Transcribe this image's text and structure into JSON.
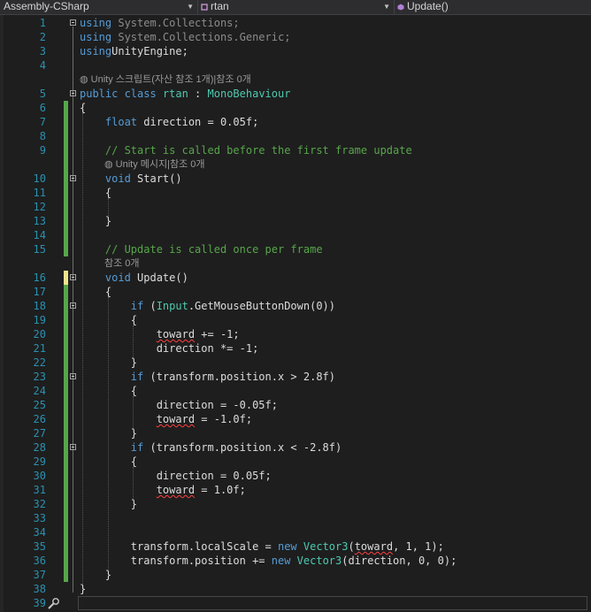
{
  "navbar": {
    "project": "Assembly-CSharp",
    "class_name": "rtan",
    "member": "Update()"
  },
  "code_lens": {
    "class_refs": "Unity 스크립트(자산 참조 1개)|참조 0개",
    "start_refs": "Unity 메시지|참조 0개",
    "update_refs": "참조 0개"
  },
  "editor": {
    "colors": {
      "background": "#1e1e1e",
      "keyword": "#569cd6",
      "type": "#4ec9b0",
      "comment": "#57a64a",
      "line_number": "#2b91af"
    },
    "lines": [
      {
        "n": "1",
        "fold": true,
        "t": [
          [
            "kw",
            "using"
          ],
          [
            "dim",
            " System.Collections;"
          ]
        ]
      },
      {
        "n": "2",
        "t": [
          [
            "kw",
            "using"
          ],
          [
            "dim",
            " System.Collections.Generic;"
          ]
        ]
      },
      {
        "n": "3",
        "t": [
          [
            "kw",
            "using"
          ],
          [
            "",
            "UnityEngine;"
          ]
        ]
      },
      {
        "n": "4",
        "t": []
      },
      {
        "lens": "class_refs",
        "indent": 0
      },
      {
        "n": "5",
        "fold": true,
        "t": [
          [
            "kw",
            "public class "
          ],
          [
            "typ",
            "rtan"
          ],
          [
            "",
            " : "
          ],
          [
            "typ",
            "MonoBehaviour"
          ]
        ]
      },
      {
        "n": "6",
        "t": [
          [
            "",
            "{"
          ]
        ]
      },
      {
        "n": "7",
        "t": [
          [
            "",
            "    "
          ],
          [
            "kw",
            "float"
          ],
          [
            "",
            " direction = 0.05f;"
          ]
        ]
      },
      {
        "n": "8",
        "t": []
      },
      {
        "n": "9",
        "t": [
          [
            "",
            "    "
          ],
          [
            "cm",
            "// Start is called before the first frame update"
          ]
        ]
      },
      {
        "lens": "start_refs",
        "indent": 1
      },
      {
        "n": "10",
        "fold": true,
        "t": [
          [
            "",
            "    "
          ],
          [
            "kw",
            "void"
          ],
          [
            "",
            " Start()"
          ]
        ]
      },
      {
        "n": "11",
        "t": [
          [
            "",
            "    {"
          ]
        ]
      },
      {
        "n": "12",
        "t": []
      },
      {
        "n": "13",
        "t": [
          [
            "",
            "    }"
          ]
        ]
      },
      {
        "n": "14",
        "t": []
      },
      {
        "n": "15",
        "t": [
          [
            "",
            "    "
          ],
          [
            "cm",
            "// Update is called once per frame"
          ]
        ]
      },
      {
        "lens": "update_refs",
        "indent": 1
      },
      {
        "n": "16",
        "fold": true,
        "t": [
          [
            "",
            "    "
          ],
          [
            "kw",
            "void"
          ],
          [
            "",
            " Update()"
          ]
        ]
      },
      {
        "n": "17",
        "t": [
          [
            "",
            "    {"
          ]
        ]
      },
      {
        "n": "18",
        "fold": true,
        "t": [
          [
            "",
            "        "
          ],
          [
            "kw",
            "if"
          ],
          [
            "",
            " ("
          ],
          [
            "typ",
            "Input"
          ],
          [
            "",
            ".GetMouseButtonDown(0))"
          ]
        ]
      },
      {
        "n": "19",
        "t": [
          [
            "",
            "        {"
          ]
        ]
      },
      {
        "n": "20",
        "t": [
          [
            "",
            "            "
          ],
          [
            "squig",
            "toward"
          ],
          [
            "",
            " += -1;"
          ]
        ]
      },
      {
        "n": "21",
        "t": [
          [
            "",
            "            direction *= -1;"
          ]
        ]
      },
      {
        "n": "22",
        "t": [
          [
            "",
            "        }"
          ]
        ]
      },
      {
        "n": "23",
        "fold": true,
        "t": [
          [
            "",
            "        "
          ],
          [
            "kw",
            "if"
          ],
          [
            "",
            " (transform.position.x > 2.8f)"
          ]
        ]
      },
      {
        "n": "24",
        "t": [
          [
            "",
            "        {"
          ]
        ]
      },
      {
        "n": "25",
        "t": [
          [
            "",
            "            direction = -0.05f;"
          ]
        ]
      },
      {
        "n": "26",
        "t": [
          [
            "",
            "            "
          ],
          [
            "squig",
            "toward"
          ],
          [
            "",
            " = -1.0f;"
          ]
        ]
      },
      {
        "n": "27",
        "t": [
          [
            "",
            "        }"
          ]
        ]
      },
      {
        "n": "28",
        "fold": true,
        "t": [
          [
            "",
            "        "
          ],
          [
            "kw",
            "if"
          ],
          [
            "",
            " (transform.position.x < -2.8f)"
          ]
        ]
      },
      {
        "n": "29",
        "t": [
          [
            "",
            "        {"
          ]
        ]
      },
      {
        "n": "30",
        "t": [
          [
            "",
            "            direction = 0.05f;"
          ]
        ]
      },
      {
        "n": "31",
        "t": [
          [
            "",
            "            "
          ],
          [
            "squig",
            "toward"
          ],
          [
            "",
            " = 1.0f;"
          ]
        ]
      },
      {
        "n": "32",
        "t": [
          [
            "",
            "        }"
          ]
        ]
      },
      {
        "n": "33",
        "t": []
      },
      {
        "n": "34",
        "t": []
      },
      {
        "n": "35",
        "t": [
          [
            "",
            "        transform.localScale = "
          ],
          [
            "kw",
            "new"
          ],
          [
            "",
            " "
          ],
          [
            "typ",
            "Vector3"
          ],
          [
            "",
            "("
          ],
          [
            "squig",
            "toward"
          ],
          [
            "",
            ", 1, 1);"
          ]
        ]
      },
      {
        "n": "36",
        "t": [
          [
            "",
            "        transform.position += "
          ],
          [
            "kw",
            "new"
          ],
          [
            "",
            " "
          ],
          [
            "typ",
            "Vector3"
          ],
          [
            "",
            "(direction, 0, 0);"
          ]
        ]
      },
      {
        "n": "37",
        "t": [
          [
            "",
            "    }"
          ]
        ]
      },
      {
        "n": "38",
        "t": [
          [
            "",
            "}"
          ]
        ]
      },
      {
        "n": "39",
        "t": []
      }
    ]
  }
}
